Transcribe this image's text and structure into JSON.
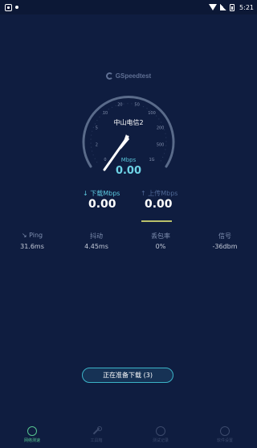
{
  "status_bar": {
    "time": "5:21"
  },
  "brand": {
    "name": "GSpeedtest"
  },
  "gauge": {
    "ticks": [
      "0",
      "2",
      "5",
      "10",
      "20",
      "50",
      "100",
      "200",
      "500",
      "1G"
    ],
    "server_name": "中山电信2",
    "unit": "Mbps",
    "value": "0.00"
  },
  "download": {
    "label": "下载Mbps",
    "value": "0.00"
  },
  "upload": {
    "label": "上传Mbps",
    "value": "0.00"
  },
  "stats": [
    {
      "label": "Ping",
      "value": "31.6ms"
    },
    {
      "label": "抖动",
      "value": "4.45ms"
    },
    {
      "label": "丢包率",
      "value": "0%"
    },
    {
      "label": "信号",
      "value": "-36dbm"
    }
  ],
  "action": {
    "label": "正在准备下载 (3)"
  },
  "nav": [
    {
      "label": "网络测速",
      "active": true
    },
    {
      "label": "工具箱"
    },
    {
      "label": "测试记录"
    },
    {
      "label": "软件设置"
    }
  ],
  "colors": {
    "background": "#0f1d40",
    "accent": "#58c4d8",
    "nav_active": "#56c490",
    "upload_underline": "#b9c06a"
  }
}
